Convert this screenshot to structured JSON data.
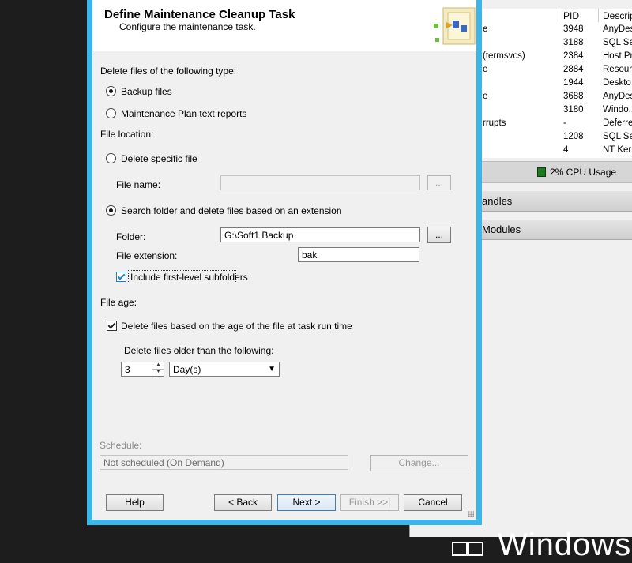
{
  "background_window": {
    "columns": {
      "pid": "PID",
      "description": "Descrip"
    },
    "processes": [
      {
        "name": "e",
        "pid": "3948",
        "description": "AnyDes"
      },
      {
        "name": "",
        "pid": "3188",
        "description": "SQL Ser"
      },
      {
        "name": "(termsvcs)",
        "pid": "2384",
        "description": "Host Pr"
      },
      {
        "name": "e",
        "pid": "2884",
        "description": "Resour"
      },
      {
        "name": "",
        "pid": "1944",
        "description": "Deskto"
      },
      {
        "name": "e",
        "pid": "3688",
        "description": "AnyDes"
      },
      {
        "name": "",
        "pid": "3180",
        "description": "Windo.."
      },
      {
        "name": "rrupts",
        "pid": "-",
        "description": "Deferre"
      },
      {
        "name": "",
        "pid": "1208",
        "description": "SQL Ser"
      },
      {
        "name": "",
        "pid": "4",
        "description": "NT Ker.."
      }
    ],
    "cpu_usage": "2% CPU Usage",
    "sections": [
      "andles",
      "Modules"
    ],
    "os_brand": "Windows S"
  },
  "dialog": {
    "title": "Define Maintenance Cleanup Task",
    "subtitle": "Configure the maintenance task.",
    "file_type": {
      "label": "Delete files of the following type:",
      "options": [
        "Backup files",
        "Maintenance Plan text reports"
      ],
      "selected": "Backup files"
    },
    "file_location": {
      "label": "File location:",
      "specific_file_label": "Delete specific file",
      "file_name_label": "File name:",
      "file_name_value": "",
      "browse_label": "...",
      "search_folder_label": "Search folder and delete files based on an extension",
      "folder_label": "Folder:",
      "folder_value": "G:\\Soft1 Backup",
      "extension_label": "File extension:",
      "extension_value": "bak",
      "subfolders_label": "Include first-level subfolders",
      "subfolders_checked": true,
      "selected": "search"
    },
    "file_age": {
      "label": "File age:",
      "delete_by_age_label": "Delete files based on the age of the file at task run time",
      "delete_by_age_checked": true,
      "older_than_label": "Delete files older than the following:",
      "amount": "3",
      "unit": "Day(s)"
    },
    "schedule": {
      "label": "Schedule:",
      "value": "Not scheduled (On Demand)",
      "change_label": "Change..."
    },
    "buttons": {
      "help": "Help",
      "back": "< Back",
      "next": "Next >",
      "finish": "Finish >>|",
      "cancel": "Cancel"
    }
  },
  "colors": {
    "dialog_border": "#3cb6e8",
    "cpu_indicator": "#1f7a1f",
    "desktop": "#1d1d1d"
  }
}
